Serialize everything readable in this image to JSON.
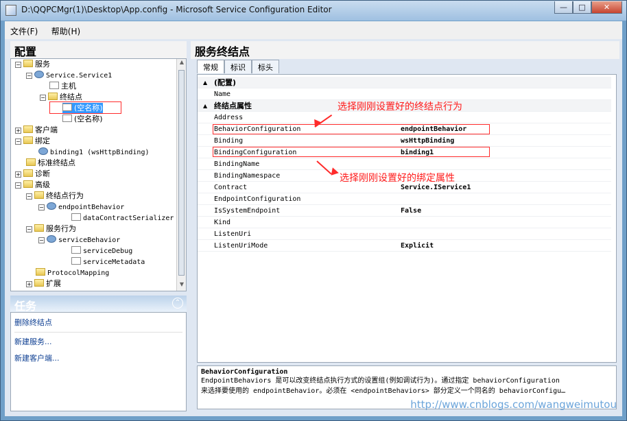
{
  "window": {
    "title": "D:\\QQPCMgr(1)\\Desktop\\App.config - Microsoft Service Configuration Editor",
    "minimize": "—",
    "maximize": "□",
    "close": "✕"
  },
  "menu": [
    "文件(F)",
    "帮助(H)"
  ],
  "left_panel": {
    "title": "配置",
    "tree": [
      {
        "label": "服务",
        "icon": "folder-icon"
      },
      {
        "label": "Service.Service1",
        "icon": "gear-icon"
      },
      {
        "label": "主机",
        "icon": "doc-icon"
      },
      {
        "label": "终结点",
        "icon": "folder-icon"
      },
      {
        "label": "(空名称)",
        "icon": "doc-icon"
      },
      {
        "label": "(空名称)",
        "icon": "doc-icon"
      },
      {
        "label": "客户端",
        "icon": "folder-icon"
      },
      {
        "label": "绑定",
        "icon": "folder-icon"
      },
      {
        "label": "binding1 (wsHttpBinding)",
        "icon": "gear-icon"
      },
      {
        "label": "标准终结点",
        "icon": "folder-icon"
      },
      {
        "label": "诊断",
        "icon": "folder-icon"
      },
      {
        "label": "高级",
        "icon": "folder-icon"
      },
      {
        "label": "终结点行为",
        "icon": "folder-icon"
      },
      {
        "label": "endpointBehavior",
        "icon": "gear-icon"
      },
      {
        "label": "dataContractSerializer",
        "icon": "doc-icon"
      },
      {
        "label": "服务行为",
        "icon": "folder-icon"
      },
      {
        "label": "serviceBehavior",
        "icon": "gear-icon"
      },
      {
        "label": "serviceDebug",
        "icon": "doc-icon"
      },
      {
        "label": "serviceMetadata",
        "icon": "doc-icon"
      },
      {
        "label": "ProtocolMapping",
        "icon": "folder-icon"
      },
      {
        "label": "扩展",
        "icon": "folder-icon"
      }
    ],
    "tasks_title": "任务",
    "tasks": [
      "删除终结点",
      "新建服务...",
      "新建客户端..."
    ]
  },
  "right_panel": {
    "title": "服务终结点",
    "tabs": [
      "常规",
      "标识",
      "标头"
    ],
    "properties": [
      {
        "section": "(配置)"
      },
      {
        "name": "Name",
        "value": ""
      },
      {
        "section": "终结点属性"
      },
      {
        "name": "Address",
        "value": ""
      },
      {
        "name": "BehaviorConfiguration",
        "value": "endpointBehavior"
      },
      {
        "name": "Binding",
        "value": "wsHttpBinding"
      },
      {
        "name": "BindingConfiguration",
        "value": "binding1"
      },
      {
        "name": "BindingName",
        "value": ""
      },
      {
        "name": "BindingNamespace",
        "value": ""
      },
      {
        "name": "Contract",
        "value": "Service.IService1"
      },
      {
        "name": "EndpointConfiguration",
        "value": ""
      },
      {
        "name": "IsSystemEndpoint",
        "value": "False"
      },
      {
        "name": "Kind",
        "value": ""
      },
      {
        "name": "ListenUri",
        "value": ""
      },
      {
        "name": "ListenUriMode",
        "value": "Explicit"
      }
    ],
    "description": {
      "title": "BehaviorConfiguration",
      "lines": [
        "EndpointBehaviors 是可以改变终结点执行方式的设置组(例如调试行为)。通过指定 behaviorConfiguration",
        "来选择要使用的 endpointBehavior。必须在 <endpointBehaviors> 部分定义一个同名的 behaviorConfigu…"
      ]
    }
  },
  "annotations": [
    "选择刚刚设置好的终结点行为",
    "选择刚刚设置好的绑定属性"
  ],
  "watermark": "http://www.cnblogs.com/wangweimutou"
}
